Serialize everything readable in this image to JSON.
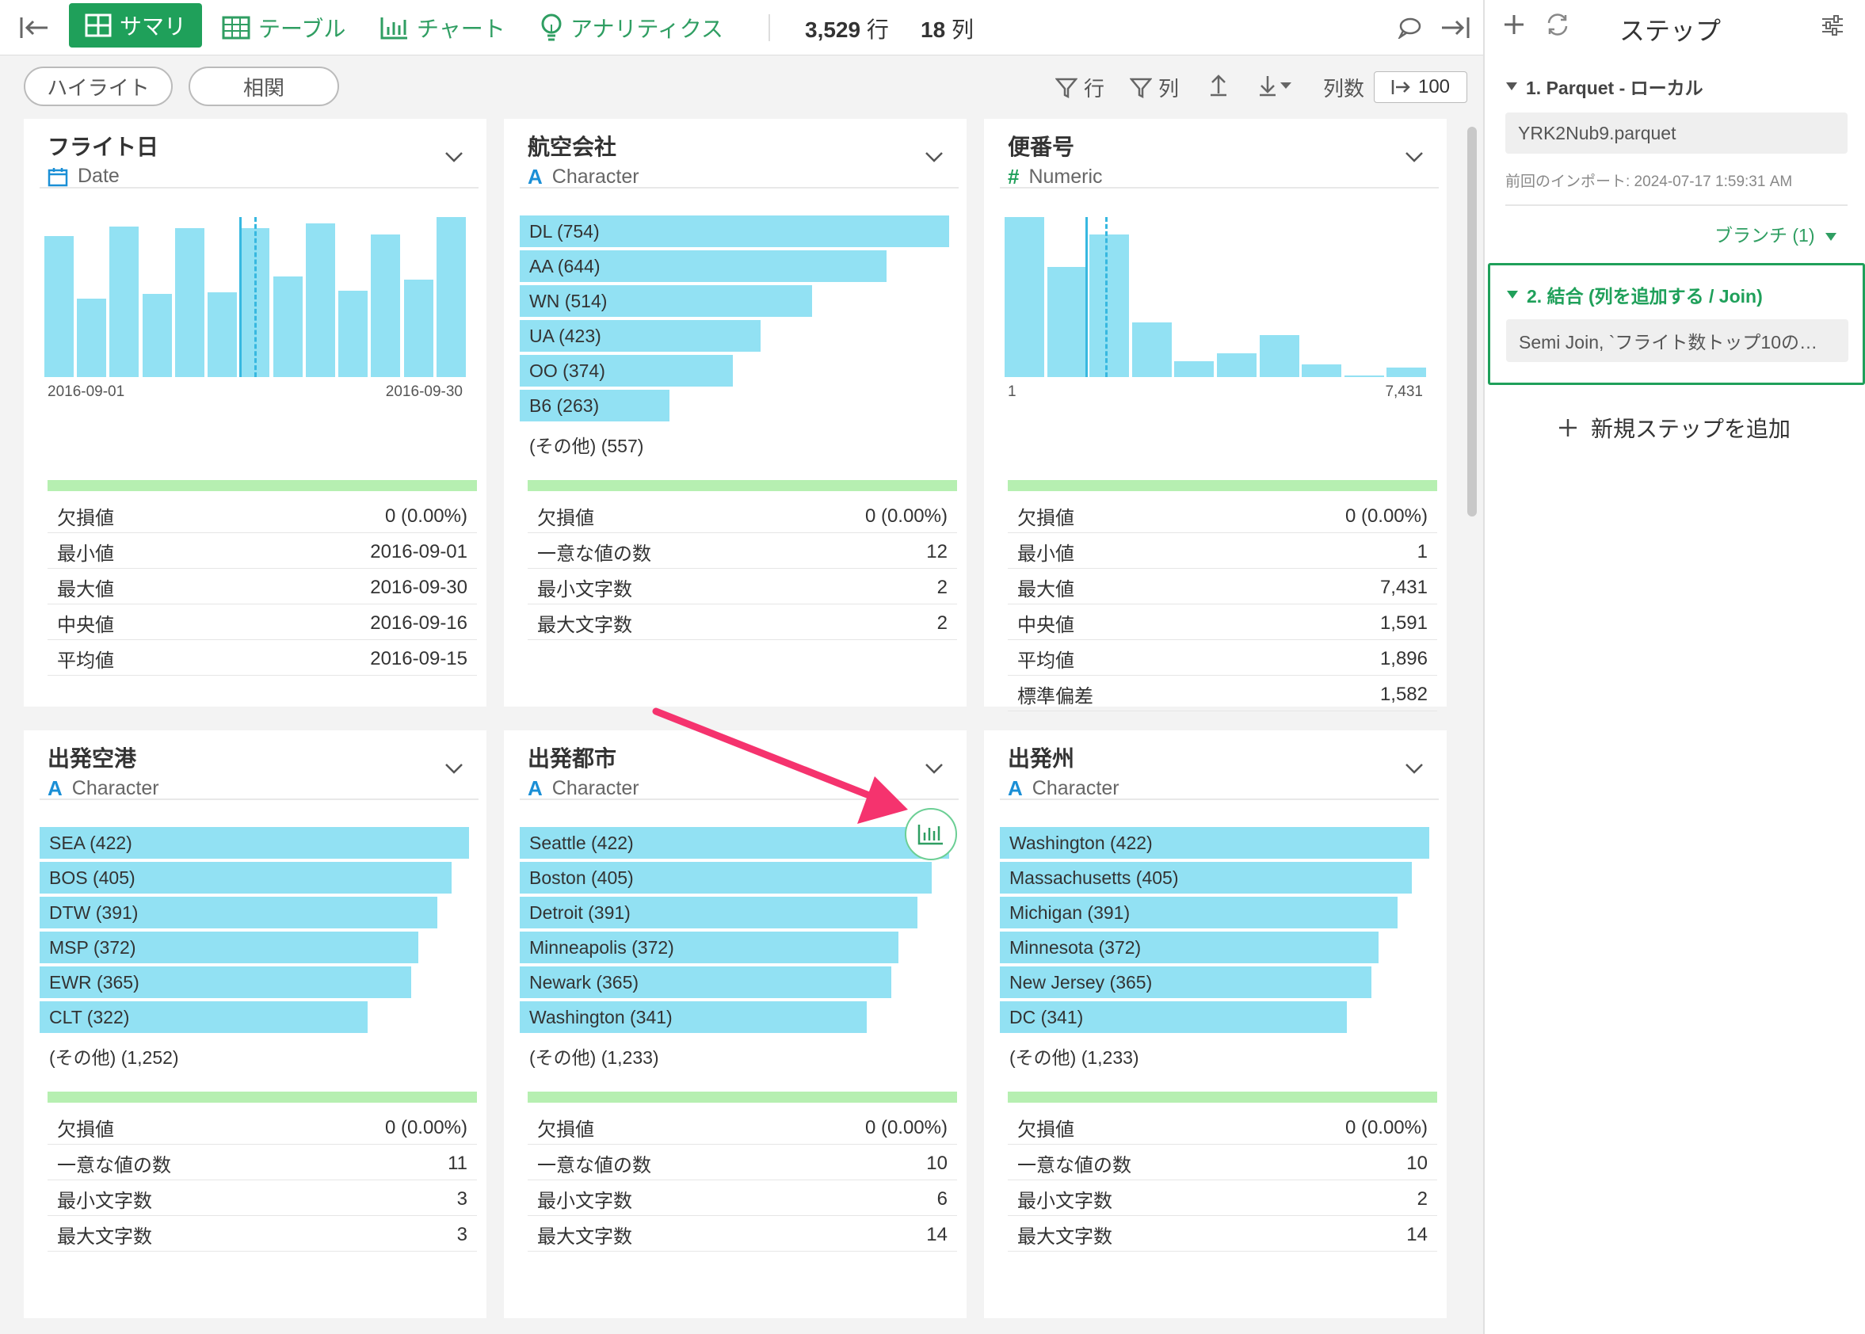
{
  "toolbar": {
    "tabs": [
      {
        "label": "サマリ",
        "icon": "summary-grid-icon",
        "active": true
      },
      {
        "label": "テーブル",
        "icon": "table-icon"
      },
      {
        "label": "チャート",
        "icon": "bar-chart-icon"
      },
      {
        "label": "アナリティクス",
        "icon": "lightbulb-icon"
      }
    ],
    "rows_value": "3,529",
    "rows_unit": "行",
    "cols_value": "18",
    "cols_unit": "列",
    "accent_color": "#1fa05a"
  },
  "filterbar": {
    "highlight": "ハイライト",
    "correlation": "相関",
    "row_filter": "行",
    "col_filter": "列",
    "col_count_label": "列数",
    "col_count_value": "100"
  },
  "cards": [
    {
      "title": "フライト日",
      "type_label": "Date",
      "type_icon": "calendar-icon",
      "chart_data": {
        "type": "bar",
        "values": [
          0.88,
          0.49,
          0.94,
          0.52,
          0.93,
          0.53,
          0.93,
          0.63,
          0.96,
          0.54,
          0.89,
          0.61,
          1.0
        ],
        "x_start": "2016-09-01",
        "x_end": "2016-09-30",
        "median_line": 0.465,
        "mean_line": 0.5
      },
      "stats": [
        {
          "label": "欠損値",
          "value": "0 (0.00%)"
        },
        {
          "label": "最小値",
          "value": "2016-09-01"
        },
        {
          "label": "最大値",
          "value": "2016-09-30"
        },
        {
          "label": "中央値",
          "value": "2016-09-16"
        },
        {
          "label": "平均値",
          "value": "2016-09-15"
        }
      ]
    },
    {
      "title": "航空会社",
      "type_label": "Character",
      "type_icon": "A",
      "chart_data": {
        "type": "bar",
        "orientation": "horizontal",
        "categories": [
          "DL (754)",
          "AA (644)",
          "WN (514)",
          "UA (423)",
          "OO (374)",
          "B6 (263)"
        ],
        "values": [
          754,
          644,
          514,
          423,
          374,
          263
        ],
        "other": "(その他) (557)"
      },
      "stats": [
        {
          "label": "欠損値",
          "value": "0 (0.00%)"
        },
        {
          "label": "一意な値の数",
          "value": "12"
        },
        {
          "label": "最小文字数",
          "value": "2"
        },
        {
          "label": "最大文字数",
          "value": "2"
        }
      ]
    },
    {
      "title": "便番号",
      "type_label": "Numeric",
      "type_icon": "#",
      "chart_data": {
        "type": "bar",
        "values": [
          1.0,
          0.69,
          0.89,
          0.34,
          0.1,
          0.15,
          0.26,
          0.08,
          0.01,
          0.06
        ],
        "x_start": "1",
        "x_end": "7,431",
        "median_line": 0.2,
        "mean_line": 0.245
      },
      "stats": [
        {
          "label": "欠損値",
          "value": "0 (0.00%)"
        },
        {
          "label": "最小値",
          "value": "1"
        },
        {
          "label": "最大値",
          "value": "7,431"
        },
        {
          "label": "中央値",
          "value": "1,591"
        },
        {
          "label": "平均値",
          "value": "1,896"
        },
        {
          "label": "標準偏差",
          "value": "1,582"
        }
      ]
    },
    {
      "title": "出発空港",
      "type_label": "Character",
      "type_icon": "A",
      "chart_data": {
        "type": "bar",
        "orientation": "horizontal",
        "categories": [
          "SEA (422)",
          "BOS (405)",
          "DTW (391)",
          "MSP (372)",
          "EWR (365)",
          "CLT (322)"
        ],
        "values": [
          422,
          405,
          391,
          372,
          365,
          322
        ],
        "other": "(その他) (1,252)"
      },
      "stats": [
        {
          "label": "欠損値",
          "value": "0 (0.00%)"
        },
        {
          "label": "一意な値の数",
          "value": "11"
        },
        {
          "label": "最小文字数",
          "value": "3"
        },
        {
          "label": "最大文字数",
          "value": "3"
        }
      ]
    },
    {
      "title": "出発都市",
      "type_label": "Character",
      "type_icon": "A",
      "chart_data": {
        "type": "bar",
        "orientation": "horizontal",
        "categories": [
          "Seattle (422)",
          "Boston (405)",
          "Detroit (391)",
          "Minneapolis (372)",
          "Newark (365)",
          "Washington (341)"
        ],
        "values": [
          422,
          405,
          391,
          372,
          365,
          341
        ],
        "other": "(その他) (1,233)"
      },
      "stats": [
        {
          "label": "欠損値",
          "value": "0 (0.00%)"
        },
        {
          "label": "一意な値の数",
          "value": "10"
        },
        {
          "label": "最小文字数",
          "value": "6"
        },
        {
          "label": "最大文字数",
          "value": "14"
        }
      ]
    },
    {
      "title": "出発州",
      "type_label": "Character",
      "type_icon": "A",
      "chart_data": {
        "type": "bar",
        "orientation": "horizontal",
        "categories": [
          "Washington (422)",
          "Massachusetts (405)",
          "Michigan (391)",
          "Minnesota (372)",
          "New Jersey (365)",
          "DC (341)"
        ],
        "values": [
          422,
          405,
          391,
          372,
          365,
          341
        ],
        "other": "(その他) (1,233)"
      },
      "stats": [
        {
          "label": "欠損値",
          "value": "0 (0.00%)"
        },
        {
          "label": "一意な値の数",
          "value": "10"
        },
        {
          "label": "最小文字数",
          "value": "2"
        },
        {
          "label": "最大文字数",
          "value": "14"
        }
      ]
    }
  ],
  "sidebar": {
    "title": "ステップ",
    "step1": {
      "label": "1. Parquet - ローカル",
      "file": "YRK2Nub9.parquet",
      "import_time": "前回のインポート: 2024-07-17 1:59:31 AM"
    },
    "branch": "ブランチ (1)",
    "step2": {
      "label": "2. 結合 (列を追加する / Join)",
      "detail": "Semi Join, `フライト数トップ10の…"
    },
    "add_step": "新規ステップを追加"
  },
  "overlay": {
    "arrow_color": "#f5336e",
    "chart_button_icon": "bar-chart-icon"
  }
}
